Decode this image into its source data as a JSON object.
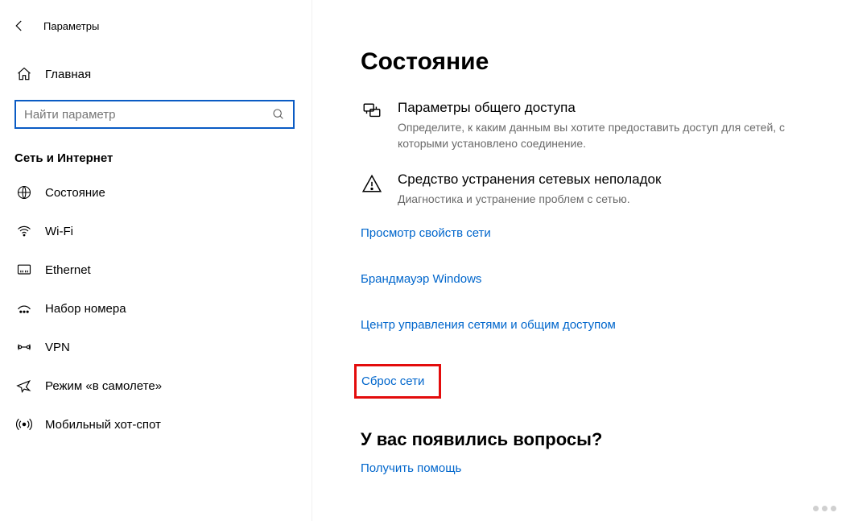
{
  "appTitle": "Параметры",
  "home": "Главная",
  "searchPlaceholder": "Найти параметр",
  "category": "Сеть и Интернет",
  "nav": {
    "status": "Состояние",
    "wifi": "Wi-Fi",
    "ethernet": "Ethernet",
    "dialup": "Набор номера",
    "vpn": "VPN",
    "airplane": "Режим «в самолете»",
    "hotspot": "Мобильный хот-спот"
  },
  "main": {
    "title": "Состояние",
    "sharing": {
      "title": "Параметры общего доступа",
      "desc": "Определите, к каким данным вы хотите предоставить доступ для сетей, с которыми установлено соединение."
    },
    "troubleshoot": {
      "title": "Средство устранения сетевых неполадок",
      "desc": "Диагностика и устранение проблем с сетью."
    },
    "links": {
      "properties": "Просмотр свойств сети",
      "firewall": "Брандмауэр Windows",
      "sharingCenter": "Центр управления сетями и общим доступом",
      "reset": "Сброс сети"
    },
    "question": "У вас появились вопросы?",
    "help": "Получить помощь"
  }
}
